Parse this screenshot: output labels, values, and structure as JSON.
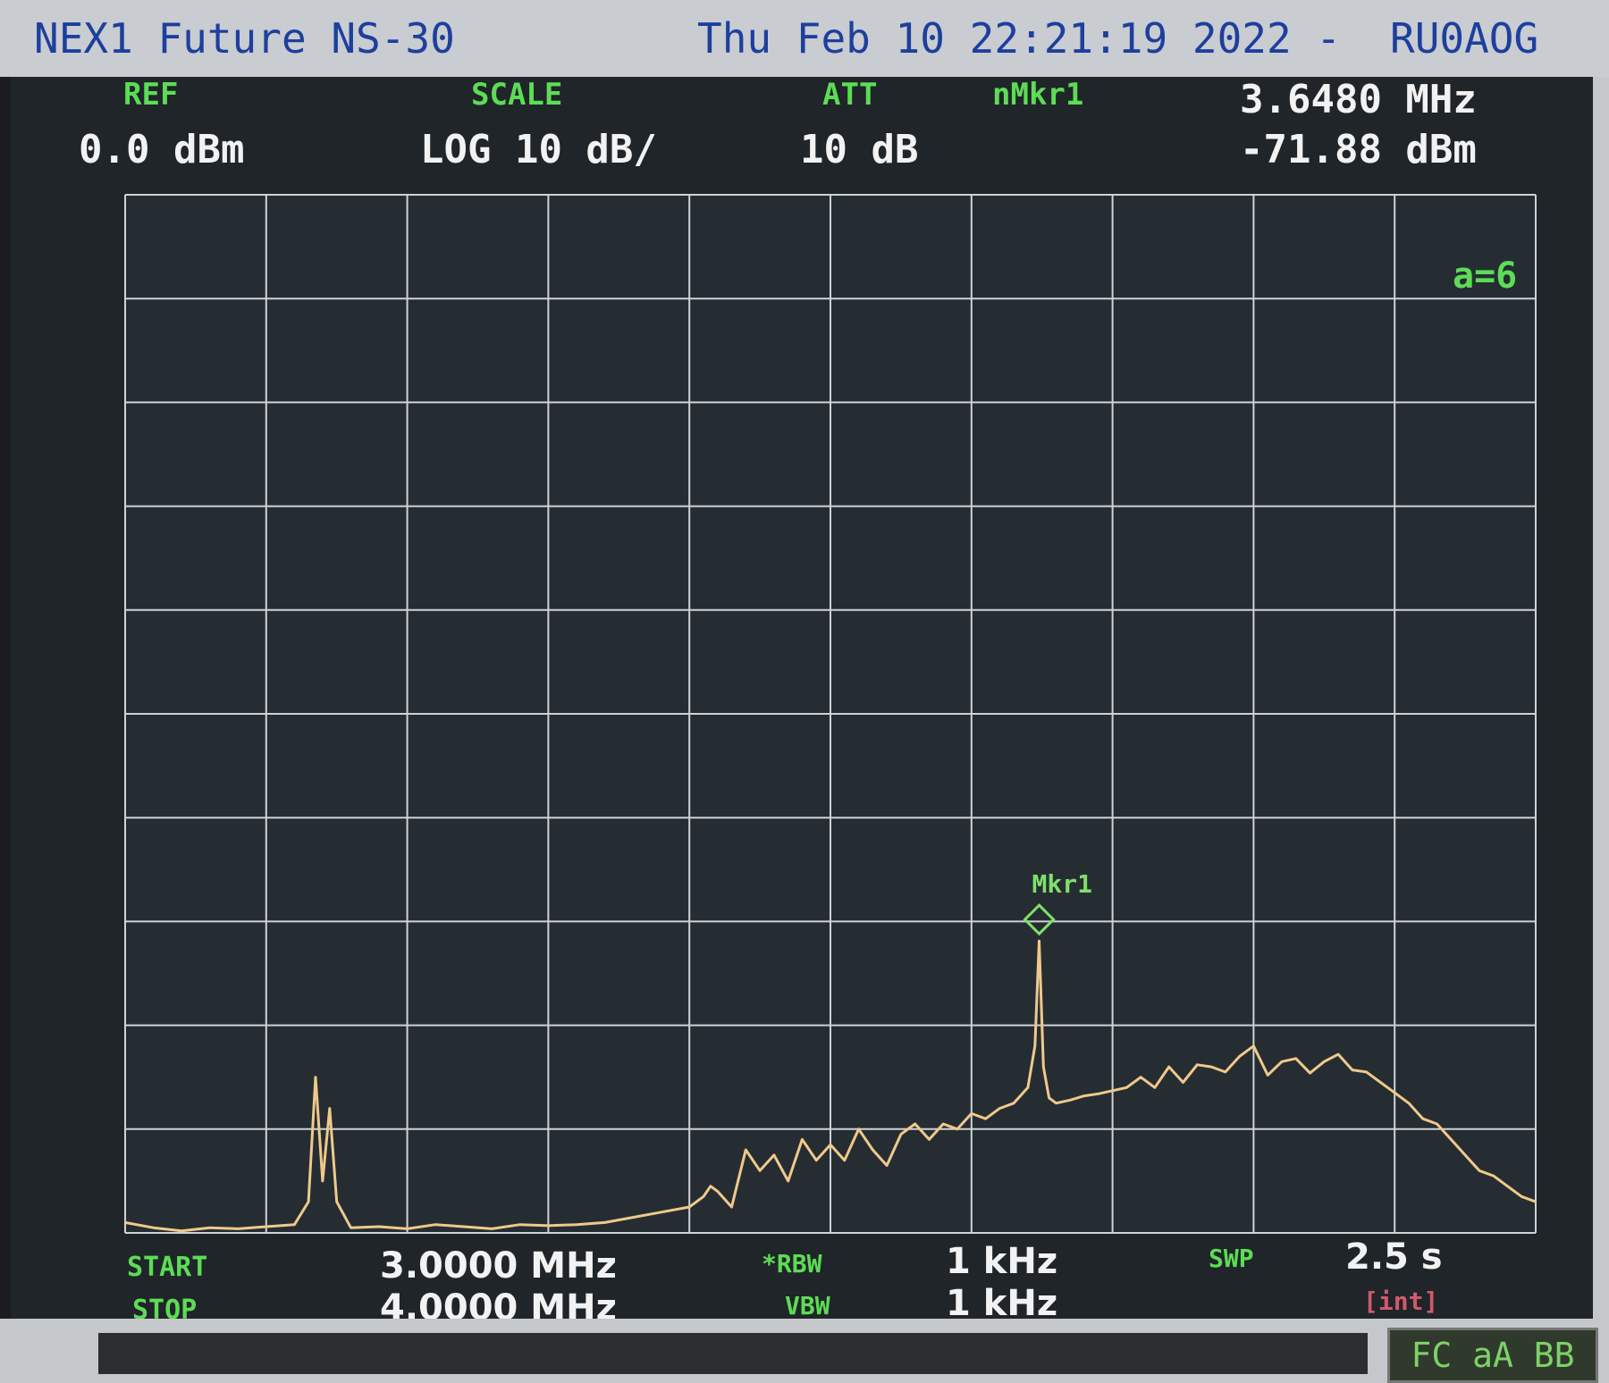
{
  "titlebar": {
    "app_title": "NEX1 Future NS-30",
    "datetime": "Thu Feb 10 22:21:19 2022 -",
    "callsign": "RU0AOG"
  },
  "header": {
    "ref_label": "REF",
    "ref_value": "0.0 dBm",
    "scale_label": "SCALE",
    "scale_value": "LOG 10 dB/",
    "att_label": "ATT",
    "att_value": "10 dB",
    "marker_label": "nMkr1",
    "marker_freq": "3.6480 MHz",
    "marker_level": "-71.88 dBm"
  },
  "trace_info": "a=6",
  "footer": {
    "start_label": "START",
    "start_value": "3.0000 MHz",
    "stop_label": "STOP",
    "stop_value": "4.0000 MHz",
    "rbw_label": "*RBW",
    "rbw_value": "1 kHz",
    "vbw_label": "VBW",
    "vbw_value": "1 kHz",
    "swp_label": "SWP",
    "swp_value": "2.5 s",
    "swp_mode": "[int]"
  },
  "status": "FC aA BB",
  "colors": {
    "screen_bg": "#1f2529",
    "grid": "#cfd3d6",
    "trace": "#f0c98a",
    "label_green": "#5ddc55",
    "value_white": "#f2f2f2",
    "title_blue": "#1d3f9e",
    "swp_mode": "#d05a6a"
  },
  "chart_data": {
    "type": "line",
    "title": "",
    "xlabel": "",
    "ylabel": "",
    "x_unit": "MHz",
    "y_unit": "dBm",
    "xlim": [
      3.0,
      4.0
    ],
    "ylim": [
      -100,
      0
    ],
    "grid": true,
    "marker": {
      "label": "Mkr1",
      "x": 3.648,
      "y": -71.88
    },
    "series": [
      {
        "x": [
          3.0,
          3.02,
          3.04,
          3.06,
          3.08,
          3.1,
          3.12,
          3.13,
          3.135,
          3.14,
          3.145,
          3.15,
          3.16,
          3.18,
          3.2,
          3.22,
          3.24,
          3.26,
          3.28,
          3.3,
          3.32,
          3.34,
          3.36,
          3.38,
          3.4,
          3.41,
          3.415,
          3.42,
          3.43,
          3.44,
          3.45,
          3.46,
          3.47,
          3.48,
          3.49,
          3.5,
          3.51,
          3.52,
          3.53,
          3.54,
          3.55,
          3.56,
          3.57,
          3.58,
          3.59,
          3.6,
          3.61,
          3.62,
          3.63,
          3.64,
          3.645,
          3.648,
          3.651,
          3.655,
          3.66,
          3.67,
          3.68,
          3.69,
          3.7,
          3.71,
          3.72,
          3.73,
          3.74,
          3.75,
          3.76,
          3.77,
          3.78,
          3.79,
          3.8,
          3.81,
          3.82,
          3.83,
          3.84,
          3.85,
          3.86,
          3.87,
          3.88,
          3.89,
          3.9,
          3.91,
          3.92,
          3.93,
          3.94,
          3.95,
          3.96,
          3.97,
          3.98,
          3.99,
          4.0
        ],
        "y": [
          -99,
          -99.5,
          -99.8,
          -99.5,
          -99.6,
          -99.4,
          -99.2,
          -97,
          -85,
          -95,
          -88,
          -97,
          -99.5,
          -99.4,
          -99.6,
          -99.2,
          -99.4,
          -99.6,
          -99.2,
          -99.3,
          -99.2,
          -99,
          -98.5,
          -98,
          -97.5,
          -96.5,
          -95.5,
          -96,
          -97.5,
          -92,
          -94,
          -92.5,
          -95,
          -91,
          -93,
          -91.5,
          -93,
          -90,
          -92,
          -93.5,
          -90.5,
          -89.5,
          -91,
          -89.5,
          -90,
          -88.5,
          -89,
          -88,
          -87.5,
          -86,
          -82,
          -71.88,
          -84,
          -87,
          -87.5,
          -87.2,
          -86.8,
          -86.6,
          -86.3,
          -86,
          -85,
          -86,
          -84,
          -85.5,
          -83.8,
          -84,
          -84.5,
          -83,
          -82,
          -84.8,
          -83.5,
          -83.2,
          -84.6,
          -83.5,
          -82.8,
          -84.3,
          -84.5,
          -85.5,
          -86.5,
          -87.5,
          -89,
          -89.5,
          -91,
          -92.5,
          -94,
          -94.5,
          -95.5,
          -96.5,
          -97
        ]
      }
    ]
  }
}
